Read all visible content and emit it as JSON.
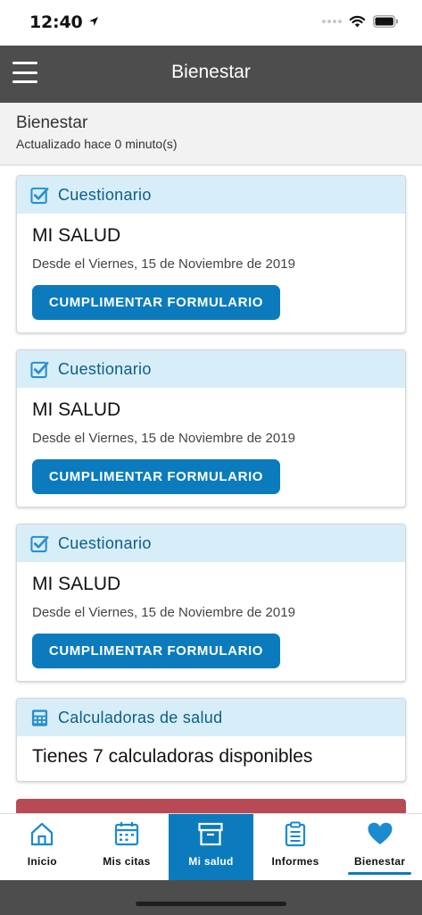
{
  "status_bar": {
    "time": "12:40"
  },
  "header": {
    "title": "Bienestar"
  },
  "page": {
    "heading": "Bienestar",
    "updated": "Actualizado hace 0 minuto(s)"
  },
  "cards": [
    {
      "header": "Cuestionario",
      "name": "MI SALUD",
      "date": "Desde el Viernes, 15 de Noviembre de 2019",
      "button": "CUMPLIMENTAR FORMULARIO"
    },
    {
      "header": "Cuestionario",
      "name": "MI SALUD",
      "date": "Desde el Viernes, 15 de Noviembre de 2019",
      "button": "CUMPLIMENTAR FORMULARIO"
    },
    {
      "header": "Cuestionario",
      "name": "MI SALUD",
      "date": "Desde el Viernes, 15 de Noviembre de 2019",
      "button": "CUMPLIMENTAR FORMULARIO"
    }
  ],
  "calculators": {
    "header": "Calculadoras de salud",
    "text": "Tienes 7 calculadoras disponibles"
  },
  "tabs": [
    {
      "label": "Inicio",
      "icon": "home-icon"
    },
    {
      "label": "Mis citas",
      "icon": "calendar-icon"
    },
    {
      "label": "Mi salud",
      "icon": "archive-box-icon"
    },
    {
      "label": "Informes",
      "icon": "clipboard-icon"
    },
    {
      "label": "Bienestar",
      "icon": "heart-icon"
    }
  ],
  "colors": {
    "header": "#4d4d4d",
    "accent": "#0b7bbd",
    "card_header_bg": "#d7eef8",
    "card_header_text": "#0b5e8a",
    "alert": "#b84a55"
  }
}
